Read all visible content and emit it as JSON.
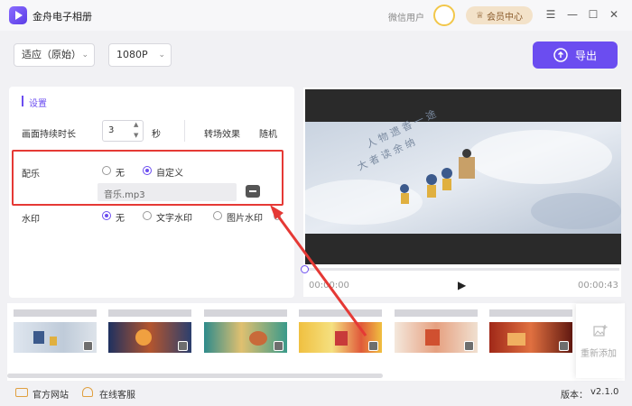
{
  "app": {
    "title": "金舟电子相册"
  },
  "header": {
    "wechat_user": "微信用户",
    "vip_label": "会员中心"
  },
  "toolbar": {
    "aspect_select": "适应（原始）",
    "resolution_select": "1080P",
    "export_label": "导出"
  },
  "settings": {
    "header": "设置",
    "duration_label": "画面持续时长",
    "duration_value": "3",
    "duration_unit": "秒",
    "transition_label": "转场效果",
    "transition_value": "随机",
    "music_label": "配乐",
    "music_options": [
      "无",
      "自定义"
    ],
    "music_selected": "自定义",
    "music_file": "音乐.mp3",
    "watermark_label": "水印",
    "watermark_options": [
      "无",
      "文字水印",
      "图片水印"
    ],
    "watermark_selected": "无"
  },
  "player": {
    "current_time": "00:00:00",
    "total_time": "00:00:43",
    "progress": 0
  },
  "timeline": {
    "add_label": "重新添加"
  },
  "footer": {
    "website_label": "官方网站",
    "support_label": "在线客服",
    "version_label": "版本：",
    "version_value": "v2.1.0"
  },
  "colors": {
    "accent": "#6b4df0",
    "highlight": "#e53935",
    "vip_bg": "#f3e2c9"
  }
}
